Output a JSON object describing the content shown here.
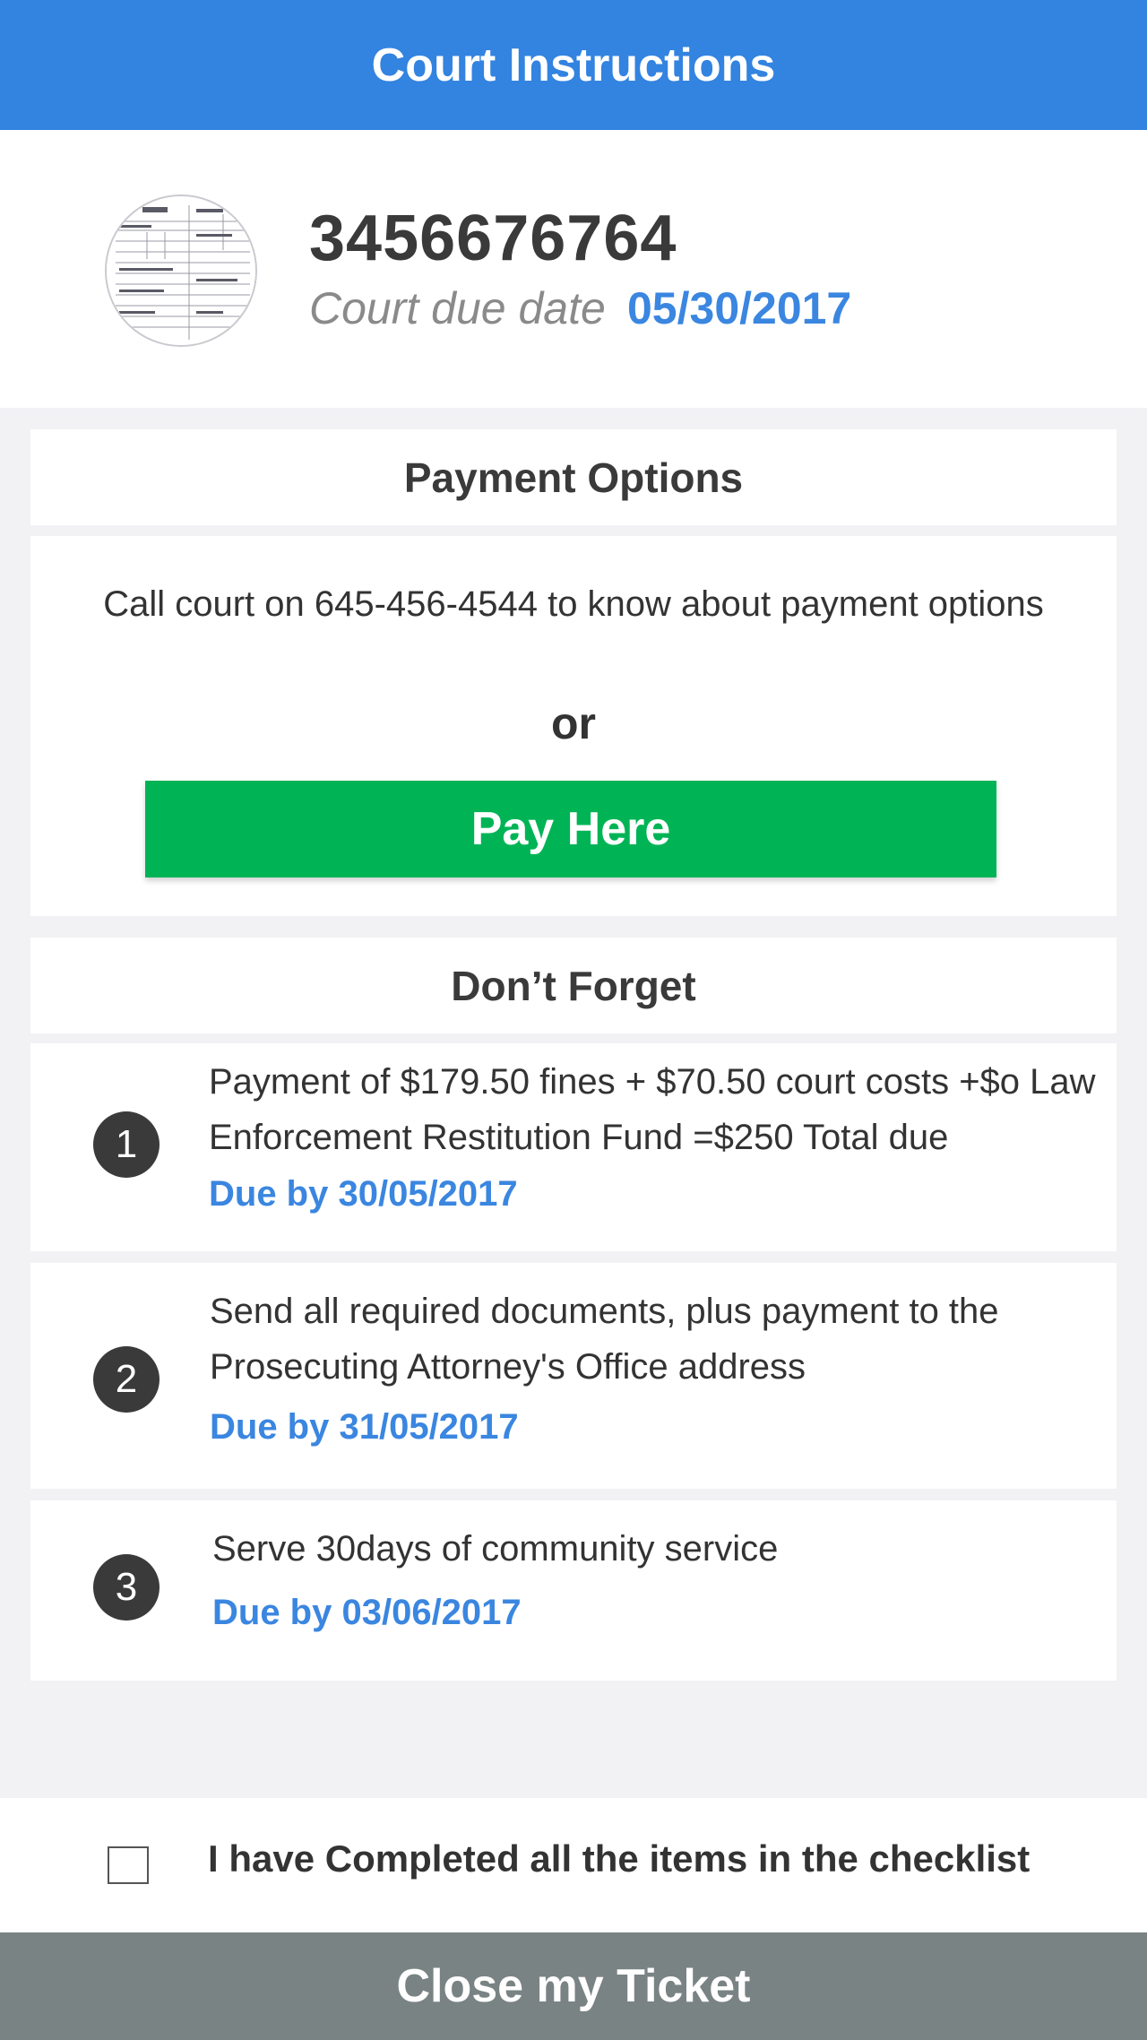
{
  "header": {
    "title": "Court Instructions"
  },
  "ticket": {
    "number": "3456676764",
    "due_label": "Court due date",
    "due_date": "05/30/2017",
    "thumbnail_icon": "ticket-document-thumbnail"
  },
  "payment": {
    "heading": "Payment Options",
    "call_text": "Call court on 645-456-4544 to know about payment options",
    "or_text": "or",
    "pay_button": "Pay Here"
  },
  "reminders": {
    "heading": "Don’t Forget",
    "items": [
      {
        "num": "1",
        "text": "Payment of $179.50 fines + $70.50 court costs +$o Law Enforcement Restitution Fund =$250 Total due",
        "due": "Due by 30/05/2017"
      },
      {
        "num": "2",
        "text": "Send all required documents, plus payment to the Prosecuting Attorney's Office address",
        "due": "Due by 31/05/2017"
      },
      {
        "num": "3",
        "text": "Serve 30days of community service",
        "due": "Due by 03/06/2017"
      }
    ]
  },
  "checklist": {
    "label": "I have Completed all the items in the checklist",
    "checked": false
  },
  "footer": {
    "close_button": "Close my Ticket"
  },
  "colors": {
    "header": "#3383e0",
    "accent_blue": "#3a86e0",
    "pay_green": "#00b456",
    "close_gray": "#7a8384",
    "background": "#f2f1f4"
  }
}
